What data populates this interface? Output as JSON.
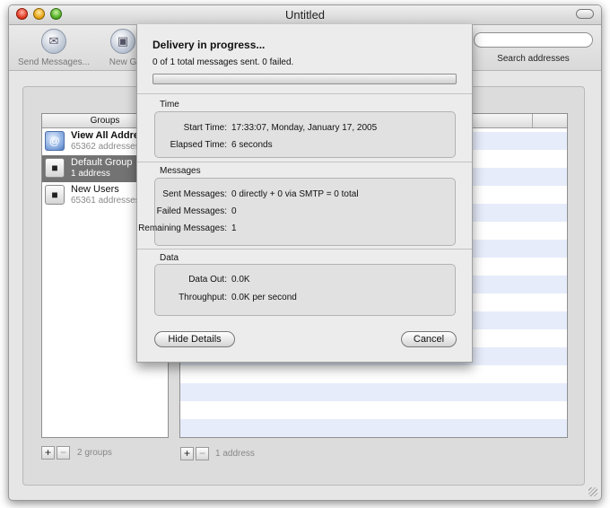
{
  "window": {
    "title": "Untitled"
  },
  "toolbar": {
    "send_label": "Send Messages...",
    "new_group_label": "New G",
    "search_label": "Search addresses",
    "search_value": ""
  },
  "groups": {
    "header": "Groups",
    "items": [
      {
        "name": "View All Addre",
        "sub": "65362 addresses",
        "icon": "at-icon"
      },
      {
        "name": "Default Group",
        "sub": "1 address",
        "icon": "group-card-icon"
      },
      {
        "name": "New Users",
        "sub": "65361 addresses",
        "icon": "group-card-icon"
      }
    ],
    "count_label": "2 groups"
  },
  "addresses": {
    "count_label": "1 address"
  },
  "sheet": {
    "title": "Delivery in progress...",
    "status": "0 of 1 total messages sent. 0 failed.",
    "progress_fraction": 0,
    "time": {
      "label": "Time",
      "start_label": "Start Time:",
      "start_value": "17:33:07, Monday, January 17, 2005",
      "elapsed_label": "Elapsed Time:",
      "elapsed_value": "6 seconds"
    },
    "messages": {
      "label": "Messages",
      "sent_label": "Sent Messages:",
      "sent_value": "0 directly + 0 via SMTP = 0 total",
      "failed_label": "Failed Messages:",
      "failed_value": "0",
      "remaining_label": "Remaining Messages:",
      "remaining_value": "1"
    },
    "data_section": {
      "label": "Data",
      "out_label": "Data Out:",
      "out_value": "0.0K",
      "throughput_label": "Throughput:",
      "throughput_value": "0.0K per second"
    },
    "hide_details_label": "Hide Details",
    "cancel_label": "Cancel"
  },
  "plus_glyph": "+",
  "minus_glyph": "−",
  "colors": {
    "selection": "#737373",
    "progress": "#3e7bd6"
  }
}
